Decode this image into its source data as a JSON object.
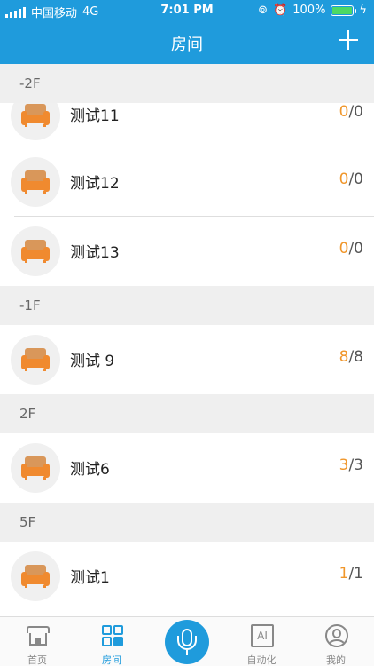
{
  "status_bar": {
    "carrier": "中国移动",
    "network": "4G",
    "time": "7:01 PM",
    "battery_text": "100%",
    "battery_level": 1.0
  },
  "header": {
    "title": "房间",
    "add_icon": "plus-icon"
  },
  "sections": [
    {
      "floor": "-2F",
      "rooms": [
        {
          "name": "测试11",
          "on": "0",
          "total": "/0"
        },
        {
          "name": "测试12",
          "on": "0",
          "total": "/0"
        },
        {
          "name": "测试13",
          "on": "0",
          "total": "/0"
        }
      ]
    },
    {
      "floor": "-1F",
      "rooms": [
        {
          "name": "测试 9",
          "on": "8",
          "total": "/8"
        }
      ]
    },
    {
      "floor": "2F",
      "rooms": [
        {
          "name": "测试6",
          "on": "3",
          "total": "/3"
        }
      ]
    },
    {
      "floor": "5F",
      "rooms": [
        {
          "name": "测试1",
          "on": "1",
          "total": "/1"
        }
      ]
    }
  ],
  "tabbar": {
    "tabs": [
      {
        "label": "首页",
        "icon": "home-icon"
      },
      {
        "label": "房间",
        "icon": "rooms-grid-icon",
        "active": true
      },
      {
        "label": "",
        "icon": "microphone-icon"
      },
      {
        "label": "自动化",
        "icon": "ai-icon",
        "icon_text": "AI"
      },
      {
        "label": "我的",
        "icon": "user-icon"
      }
    ]
  },
  "colors": {
    "accent": "#1f9bdc",
    "count_highlight": "#f0962a",
    "section_bg": "#efefef"
  }
}
